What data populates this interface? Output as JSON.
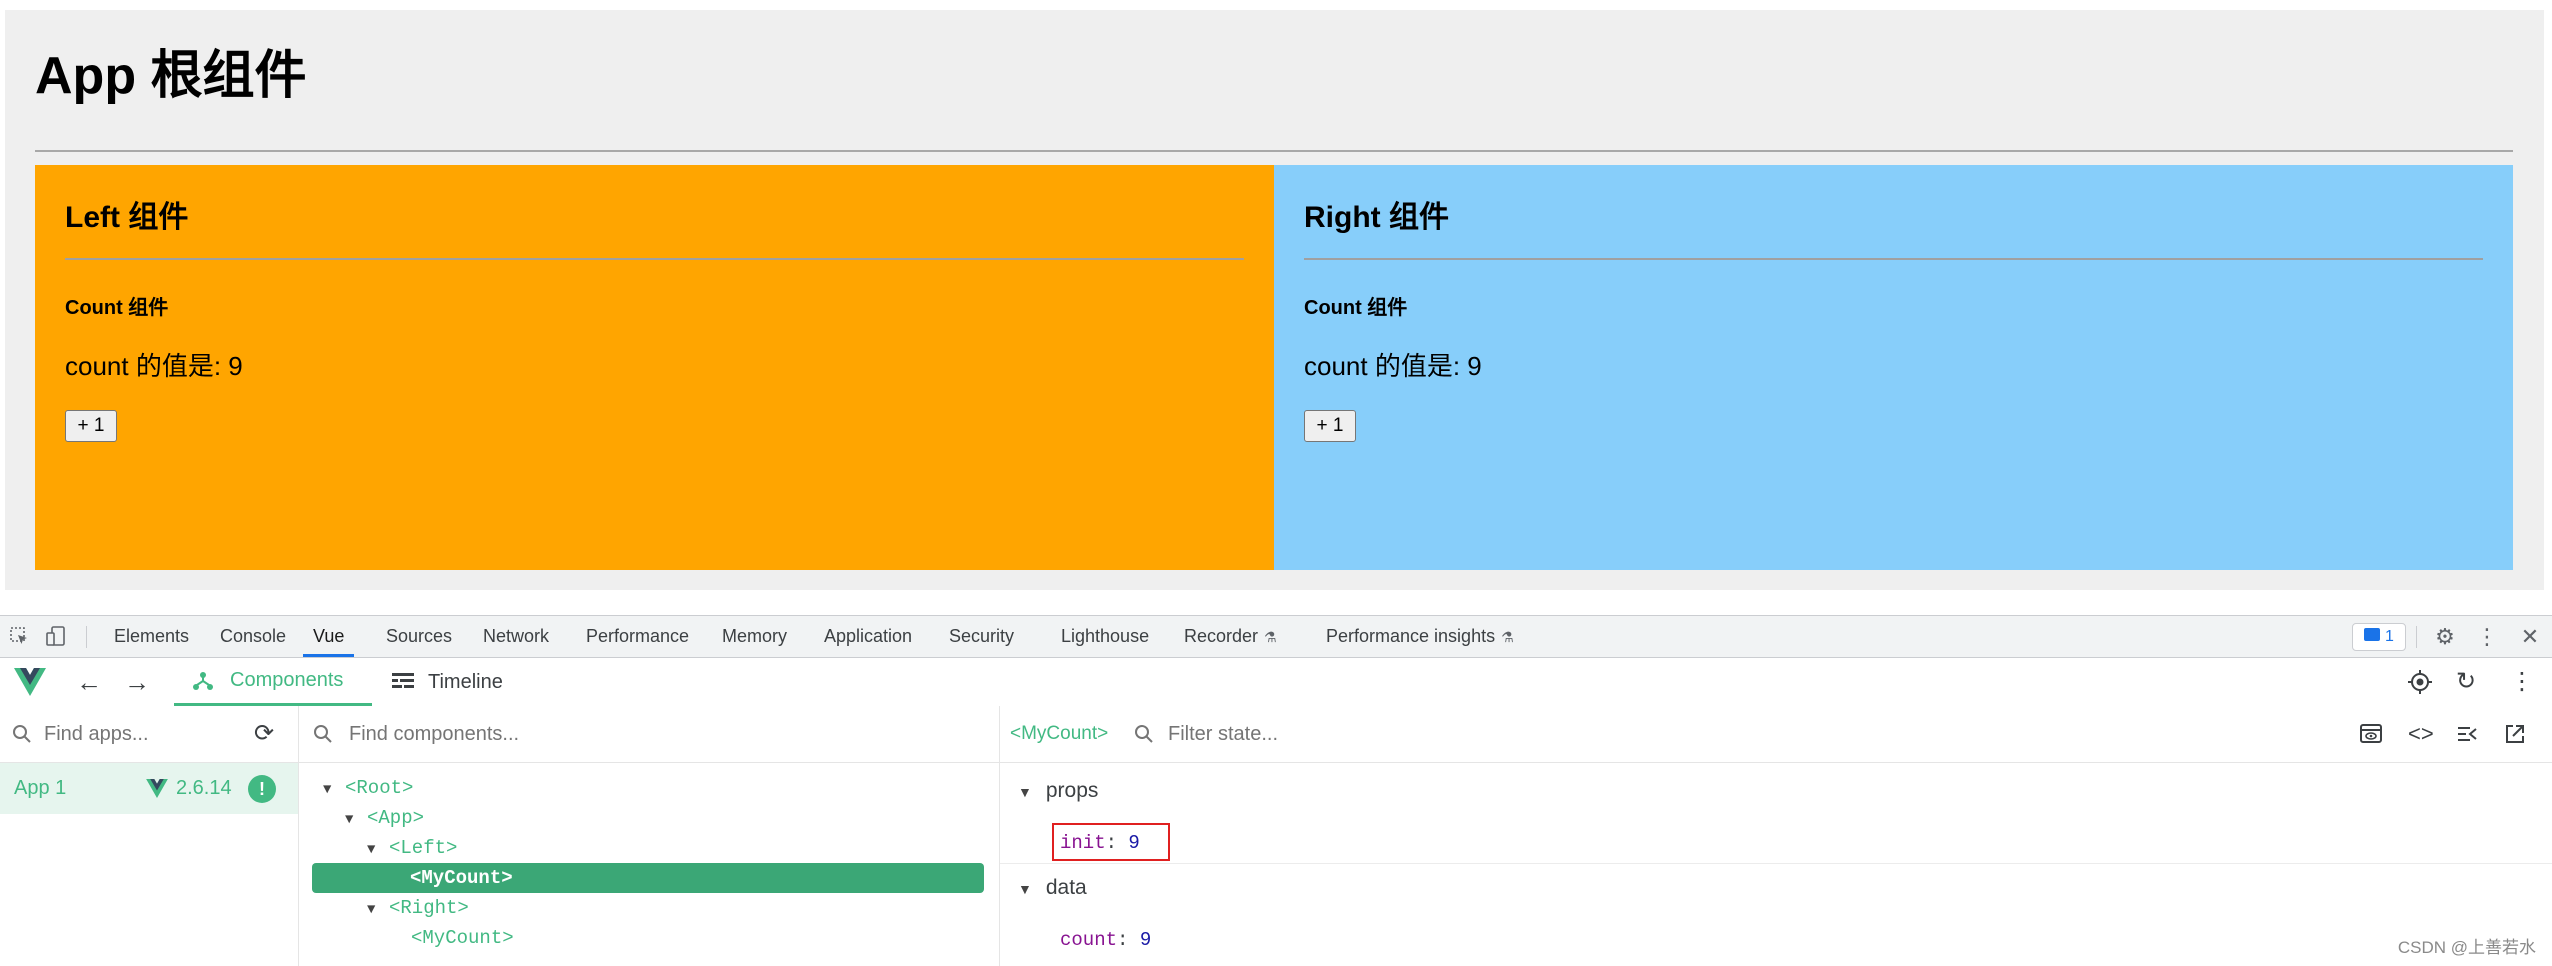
{
  "app": {
    "title": "App 根组件",
    "left": {
      "title": "Left 组件",
      "count_title": "Count 组件",
      "count_label": "count 的值是: ",
      "count_value": "9",
      "button_label": "+ 1",
      "color": "#ffa500"
    },
    "right": {
      "title": "Right 组件",
      "count_title": "Count 组件",
      "count_label": "count 的值是: ",
      "count_value": "9",
      "button_label": "+ 1",
      "color": "#87cefa"
    }
  },
  "devtools": {
    "tabs": [
      {
        "label": "Elements"
      },
      {
        "label": "Console"
      },
      {
        "label": "Vue"
      },
      {
        "label": "Sources"
      },
      {
        "label": "Network"
      },
      {
        "label": "Performance"
      },
      {
        "label": "Memory"
      },
      {
        "label": "Application"
      },
      {
        "label": "Security"
      },
      {
        "label": "Lighthouse"
      },
      {
        "label": "Recorder"
      },
      {
        "label": "Performance insights"
      }
    ],
    "active_tab": "Vue",
    "issues_count": "1",
    "accent_color": "#1a73e8"
  },
  "vue": {
    "components_tab": "Components",
    "timeline_tab": "Timeline",
    "find_apps_placeholder": "Find apps...",
    "find_components_placeholder": "Find components...",
    "filter_state_placeholder": "Filter state...",
    "app_name": "App 1",
    "vue_version": "2.6.14",
    "brand_color": "#42b983",
    "tree": [
      {
        "label": "<Root>"
      },
      {
        "label": "<App>"
      },
      {
        "label": "<Left>"
      },
      {
        "label": "<MyCount>"
      },
      {
        "label": "<Right>"
      },
      {
        "label": "<MyCount>"
      }
    ],
    "selected_component": "<MyCount>",
    "props_title": "props",
    "props": [
      {
        "key": "init",
        "value": "9"
      }
    ],
    "data_title": "data",
    "data": [
      {
        "key": "count",
        "value": "9"
      }
    ]
  },
  "watermark": "CSDN @上善若水"
}
